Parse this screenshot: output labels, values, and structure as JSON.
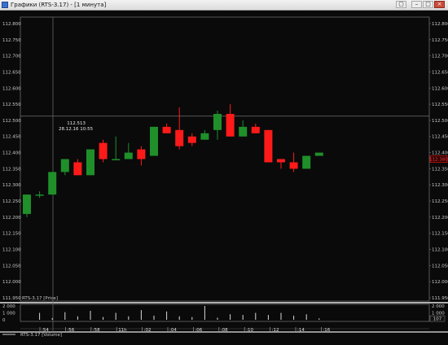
{
  "window": {
    "title": "Графики (RTS-3.17) - [1 минута]",
    "restore_label": "▢",
    "minimize_label": "–",
    "maximize_label": "□",
    "close_label": "×"
  },
  "price_panel": {
    "label": "RTS-3.17 [Price]",
    "y_ticks": [
      "112.800",
      "112.750",
      "112.700",
      "112.650",
      "112.600",
      "112.550",
      "112.500",
      "112.450",
      "112.400",
      "112.350",
      "112.300",
      "112.250",
      "112.200",
      "112.150",
      "112.100",
      "112.050",
      "112.000",
      "111.950"
    ],
    "current_price": "112.380",
    "crosshair": {
      "price": "112.513",
      "time": "28.12.16 10:55"
    }
  },
  "volume_panel": {
    "label": "RTS-3.17 [Volume]",
    "left_ticks": [
      "2 000",
      "1 000",
      "0"
    ],
    "right_ticks": [
      "2 000",
      "1 000",
      "0"
    ],
    "right_badge": "107"
  },
  "time_axis": {
    "labels": [
      ":54",
      ":56",
      ":58",
      "11h",
      ":02",
      ":04",
      ":06",
      ":08",
      ":10",
      ":12",
      ":14",
      ":16"
    ]
  },
  "colors": {
    "up": "#1f8f2a",
    "down": "#ff1a1a",
    "axis": "#c8c8c8",
    "grid": "#555555",
    "background": "#0a0a0a"
  },
  "chart_data": {
    "type": "candlestick",
    "ylim": [
      111.94,
      112.82
    ],
    "candles": [
      {
        "open": 112.21,
        "close": 112.27,
        "high": 112.27,
        "low": 112.2
      },
      {
        "open": 112.27,
        "close": 112.27,
        "high": 112.28,
        "low": 112.26
      },
      {
        "open": 112.27,
        "close": 112.34,
        "high": 112.34,
        "low": 112.27
      },
      {
        "open": 112.34,
        "close": 112.38,
        "high": 112.38,
        "low": 112.33
      },
      {
        "open": 112.37,
        "close": 112.33,
        "high": 112.38,
        "low": 112.33
      },
      {
        "open": 112.33,
        "close": 112.41,
        "high": 112.41,
        "low": 112.33
      },
      {
        "open": 112.43,
        "close": 112.38,
        "high": 112.44,
        "low": 112.37
      },
      {
        "open": 112.38,
        "close": 112.38,
        "high": 112.45,
        "low": 112.38
      },
      {
        "open": 112.38,
        "close": 112.4,
        "high": 112.43,
        "low": 112.38
      },
      {
        "open": 112.41,
        "close": 112.38,
        "high": 112.42,
        "low": 112.36
      },
      {
        "open": 112.39,
        "close": 112.48,
        "high": 112.48,
        "low": 112.39
      },
      {
        "open": 112.48,
        "close": 112.46,
        "high": 112.49,
        "low": 112.46
      },
      {
        "open": 112.47,
        "close": 112.42,
        "high": 112.54,
        "low": 112.41
      },
      {
        "open": 112.45,
        "close": 112.43,
        "high": 112.46,
        "low": 112.42
      },
      {
        "open": 112.44,
        "close": 112.46,
        "high": 112.47,
        "low": 112.44
      },
      {
        "open": 112.47,
        "close": 112.52,
        "high": 112.53,
        "low": 112.44
      },
      {
        "open": 112.52,
        "close": 112.45,
        "high": 112.55,
        "low": 112.45
      },
      {
        "open": 112.45,
        "close": 112.48,
        "high": 112.5,
        "low": 112.45
      },
      {
        "open": 112.48,
        "close": 112.46,
        "high": 112.49,
        "low": 112.46
      },
      {
        "open": 112.47,
        "close": 112.37,
        "high": 112.47,
        "low": 112.37
      },
      {
        "open": 112.38,
        "close": 112.37,
        "high": 112.38,
        "low": 112.35
      },
      {
        "open": 112.37,
        "close": 112.35,
        "high": 112.4,
        "low": 112.34
      },
      {
        "open": 112.35,
        "close": 112.39,
        "high": 112.39,
        "low": 112.35
      },
      {
        "open": 112.39,
        "close": 112.4,
        "high": 112.4,
        "low": 112.39
      }
    ],
    "volumes": [
      0,
      1000,
      250,
      1100,
      500,
      1300,
      400,
      1000,
      500,
      1400,
      600,
      1200,
      500,
      400,
      2000,
      300,
      800,
      700,
      1000,
      700,
      1000,
      600,
      800,
      200
    ]
  }
}
